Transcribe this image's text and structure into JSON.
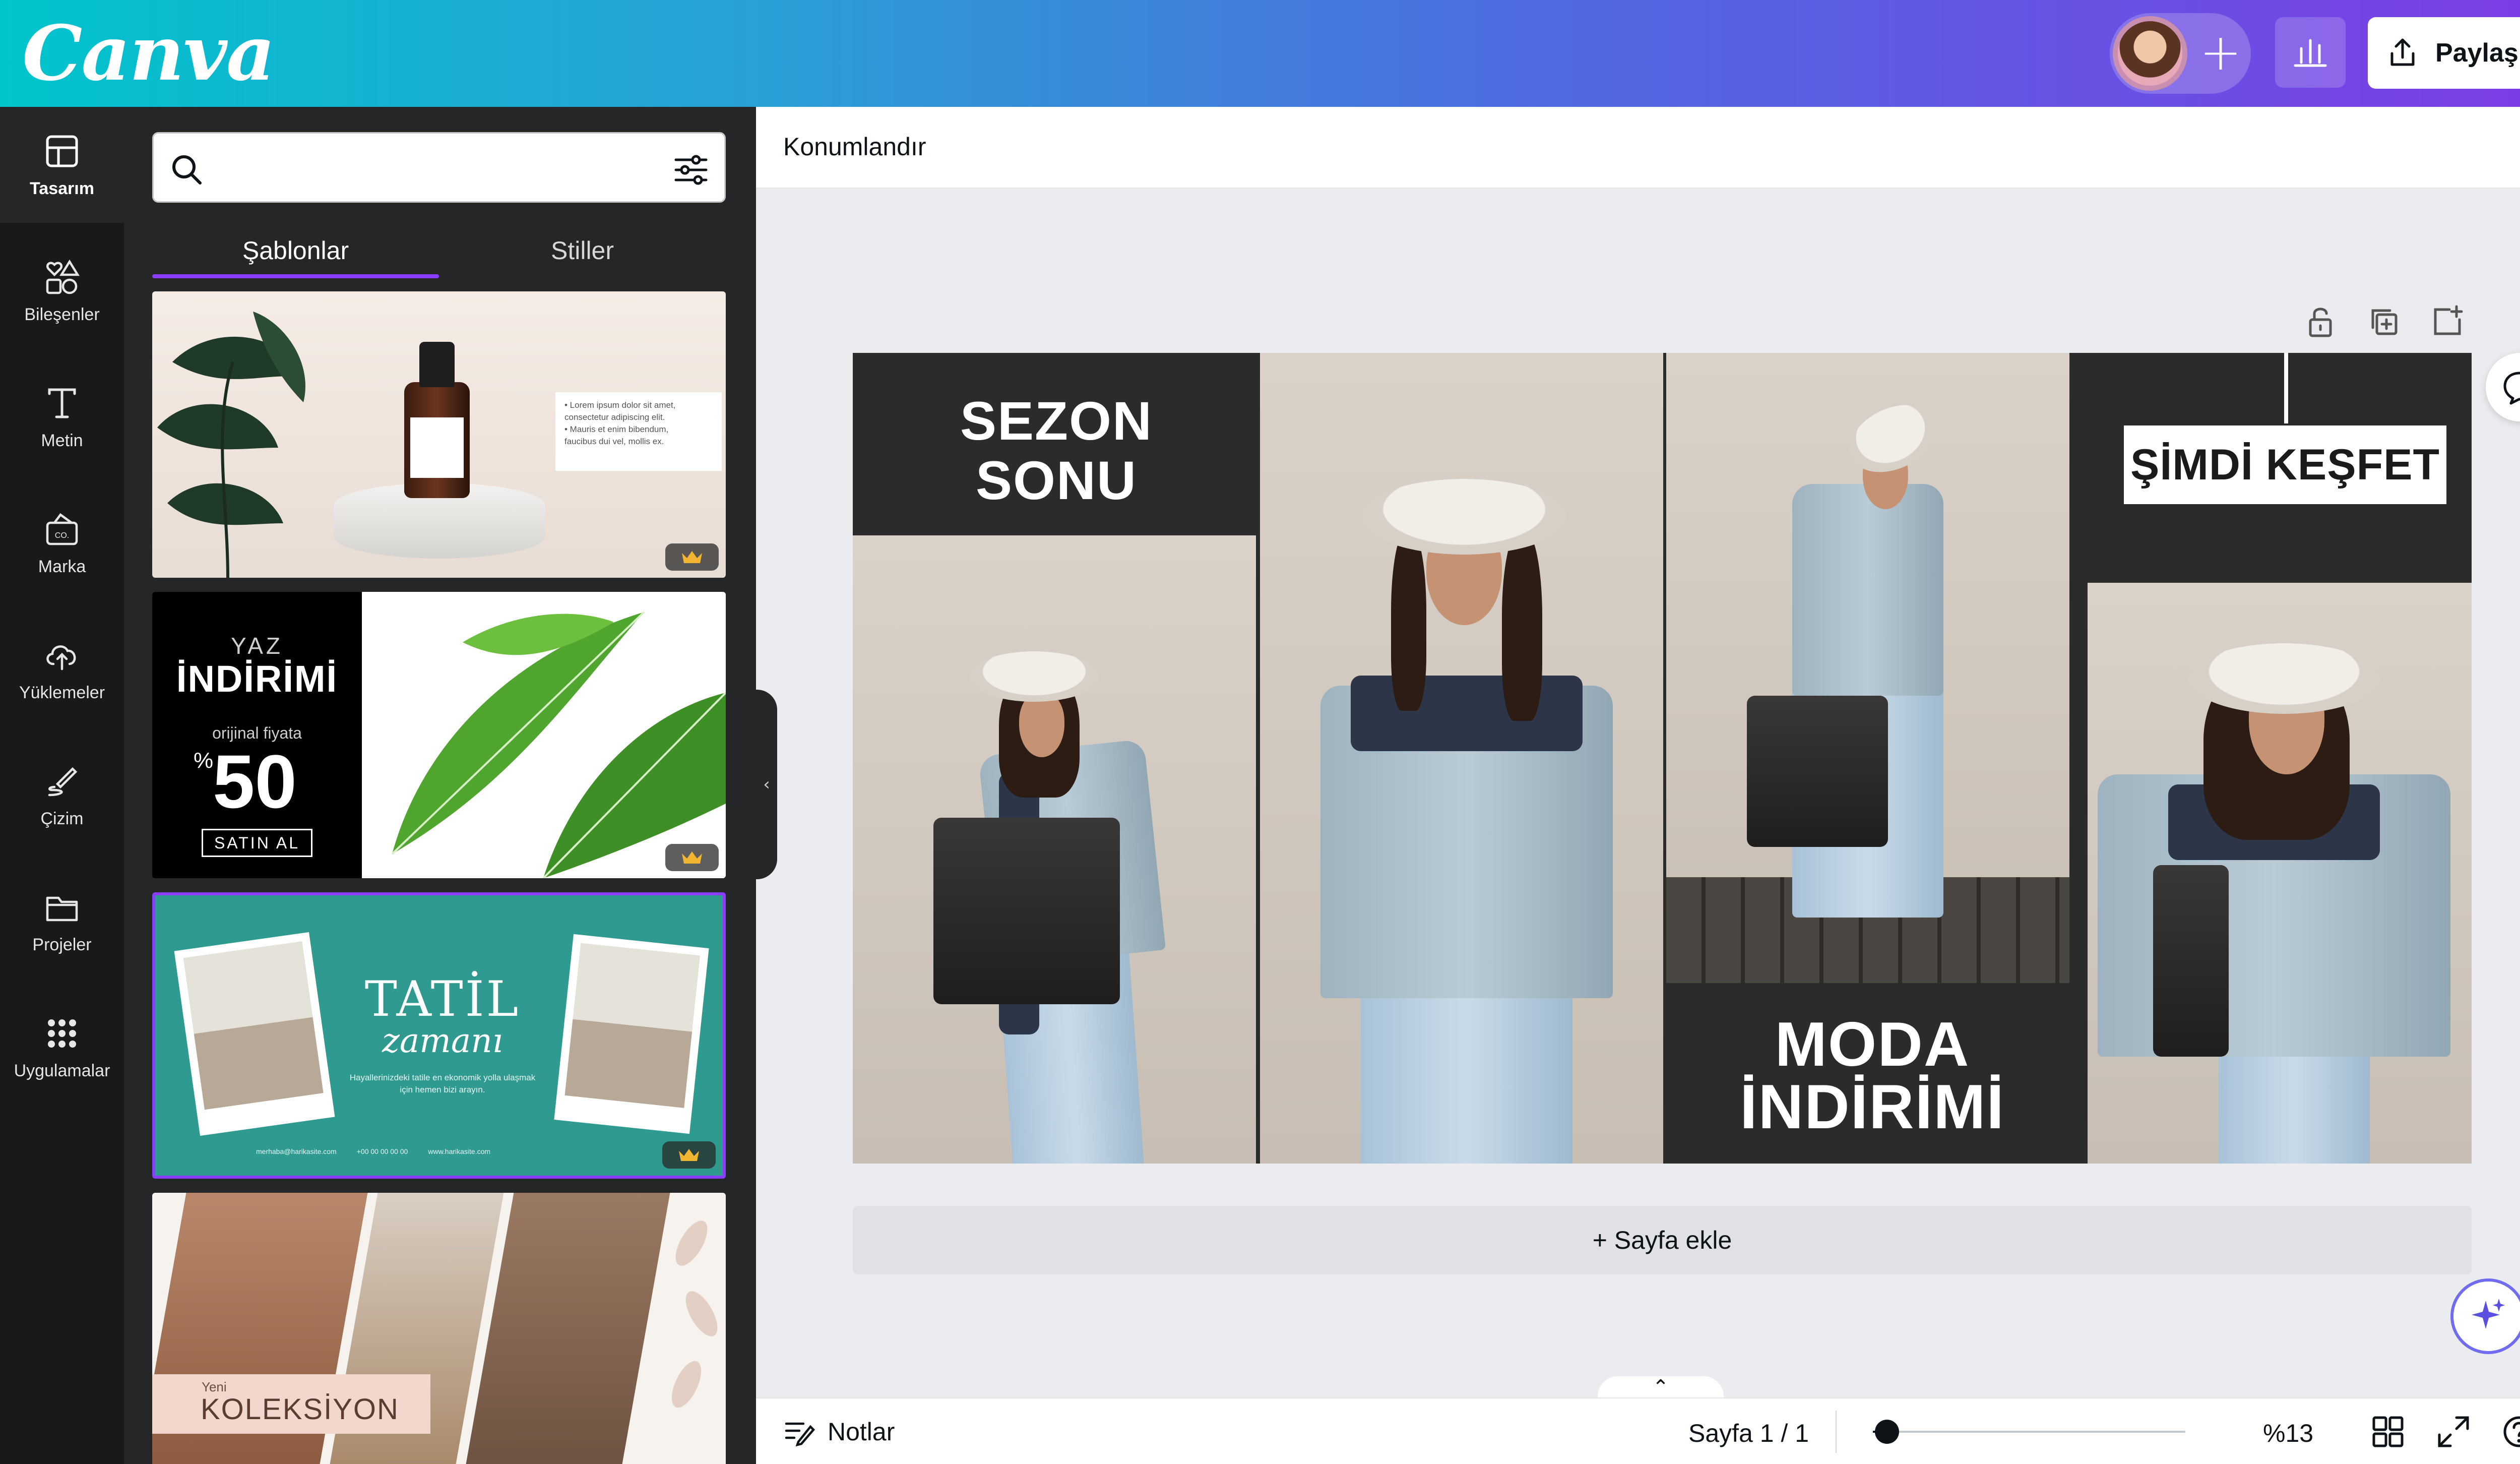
{
  "app": {
    "logo": "Canva"
  },
  "header": {
    "share_label": "Paylaş",
    "icons": [
      "avatar",
      "plus-icon",
      "analytics-icon",
      "share-icon"
    ]
  },
  "rail": {
    "items": [
      {
        "label": "Tasarım",
        "icon": "layout-icon",
        "active": true
      },
      {
        "label": "Bileşenler",
        "icon": "elements-icon"
      },
      {
        "label": "Metin",
        "icon": "text-icon"
      },
      {
        "label": "Marka",
        "icon": "brand-icon"
      },
      {
        "label": "Yüklemeler",
        "icon": "upload-cloud-icon"
      },
      {
        "label": "Çizim",
        "icon": "draw-icon"
      },
      {
        "label": "Projeler",
        "icon": "folder-icon"
      },
      {
        "label": "Uygulamalar",
        "icon": "apps-grid-icon"
      }
    ]
  },
  "panel": {
    "search": {
      "placeholder": "",
      "value": ""
    },
    "tabs": [
      {
        "label": "Şablonlar",
        "active": true
      },
      {
        "label": "Stiller"
      }
    ],
    "templates": [
      {
        "name": "serum-template",
        "bullets": [
          "• Lorem ipsum dolor sit amet,",
          "  consectetur adipiscing elit.",
          "• Mauris et enim bibendum,",
          "  faucibus dui vel, mollis ex."
        ],
        "premium": true
      },
      {
        "name": "yaz-indirimi-template",
        "yaz": "YAZ",
        "indirimi": "İNDİRİMİ",
        "orijinal": "orijinal fiyata",
        "percent_sign": "%",
        "value": "50",
        "cta": "SATIN AL",
        "premium": true
      },
      {
        "name": "tatil-template",
        "title": "TATİL",
        "subtitle": "zamanı",
        "desc": "Hayallerinizdeki tatile en ekonomik yolla ulaşmak için hemen bizi arayın.",
        "contact": [
          "merhaba@harikasite.com",
          "+00 00 00 00 00",
          "www.harikasite.com"
        ],
        "premium": true
      },
      {
        "name": "koleksiyon-template",
        "small": "Yeni",
        "title": "KOLEKSİYON"
      }
    ]
  },
  "toolbar": {
    "position_label": "Konumlandır"
  },
  "design": {
    "headline_1": [
      "SEZON",
      "SONU"
    ],
    "headline_2": [
      "MODA",
      "İNDİRİMİ"
    ],
    "cta": "ŞİMDİ KEŞFET"
  },
  "canvas": {
    "add_page_label": "+ Sayfa ekle"
  },
  "footer": {
    "notes_label": "Notlar",
    "page_indicator": "Sayfa 1 / 1",
    "zoom_label": "%13",
    "zoom_fraction": 0.13
  },
  "colors": {
    "accent": "#8b3dff",
    "rail_bg": "#18191b",
    "panel_bg": "#252627",
    "design_dark": "#2b2b2b"
  }
}
